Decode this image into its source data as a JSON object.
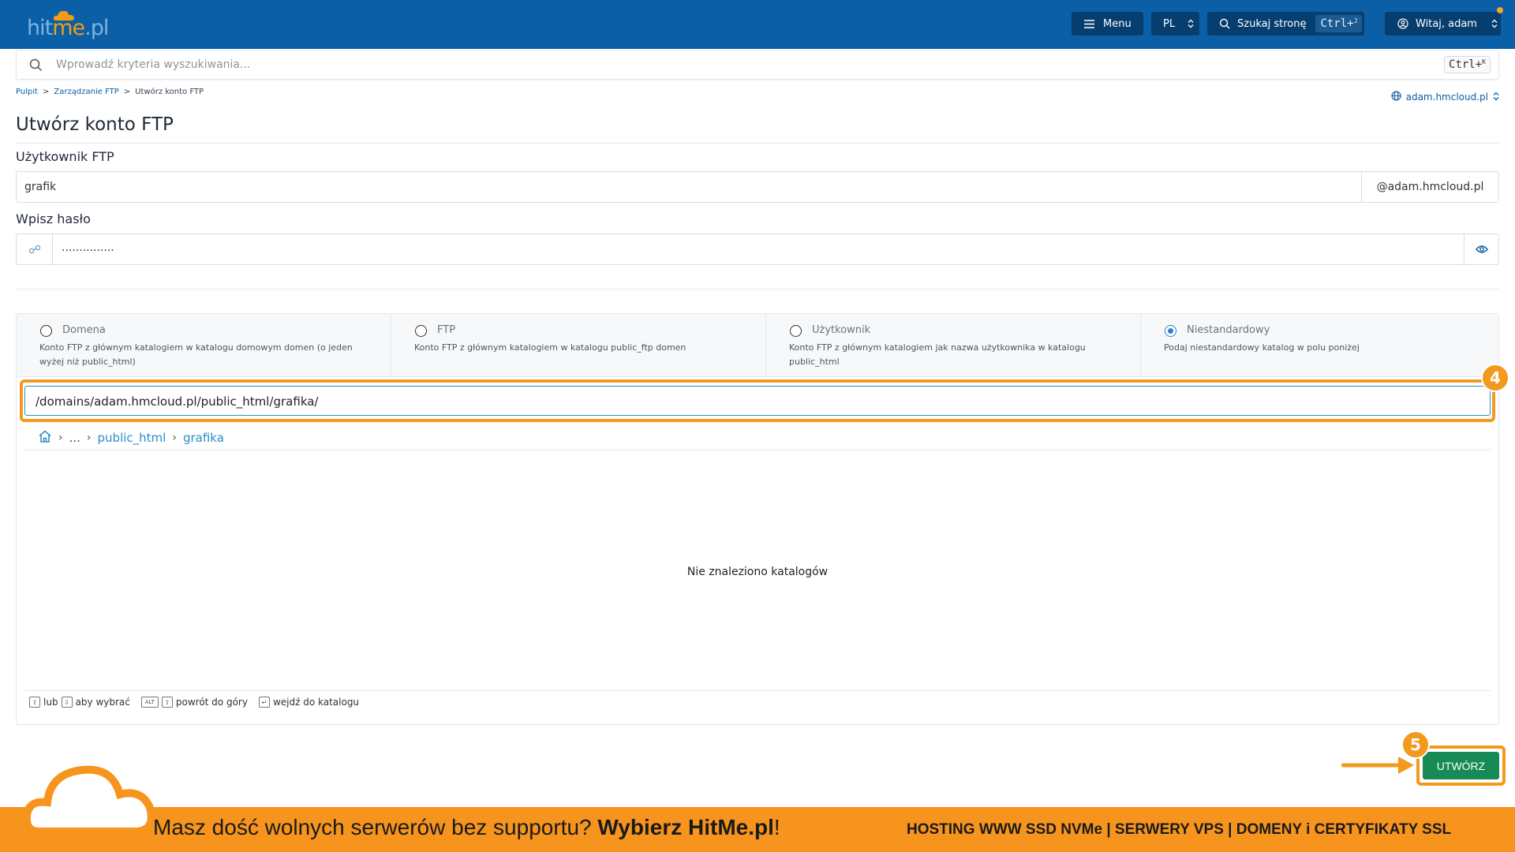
{
  "topbar": {
    "logo": {
      "part1": "hit",
      "part2": "me",
      "part3": ".pl"
    },
    "menu_label": "Menu",
    "lang_label": "PL",
    "search_label": "Szukaj stronę",
    "search_shortcut": "Ctrl+",
    "search_shortcut_key": "J",
    "user_label": "Witaj, adam"
  },
  "search": {
    "placeholder": "Wprowadź kryteria wyszukiwania...",
    "shortcut": "Ctrl+",
    "shortcut_key": "K"
  },
  "breadcrumb": {
    "items": [
      "Pulpit",
      "Zarządzanie FTP",
      "Utwórz konto FTP"
    ],
    "separator": ">"
  },
  "domain_selector": {
    "label": "adam.hmcloud.pl"
  },
  "page": {
    "title": "Utwórz konto FTP"
  },
  "form": {
    "user_label": "Użytkownik FTP",
    "user_value": "grafik",
    "user_suffix": "@adam.hmcloud.pl",
    "password_label": "Wpisz hasło",
    "password_value": "..............."
  },
  "options": [
    {
      "title": "Domena",
      "desc": "Konto FTP z głównym katalogiem w katalogu domowym domen (o jeden wyżej niż public_html)",
      "selected": false
    },
    {
      "title": "FTP",
      "desc": "Konto FTP z głównym katalogiem w katalogu public_ftp domen",
      "selected": false
    },
    {
      "title": "Użytkownik",
      "desc": "Konto FTP z głównym katalogiem jak nazwa użytkownika w katalogu public_html",
      "selected": false
    },
    {
      "title": "Niestandardowy",
      "desc": "Podaj niestandardowy katalog w polu poniżej",
      "selected": true
    }
  ],
  "path": {
    "value": "/domains/adam.hmcloud.pl/public_html/grafika/"
  },
  "file_browser": {
    "crumbs": {
      "dots": "...",
      "folder1": "public_html",
      "folder2": "grafika"
    },
    "empty_text": "Nie znaleziono katalogów",
    "hints": {
      "or": "lub",
      "to_select": "aby wybrać",
      "alt_key": "ALT",
      "back_up": "powrót do góry",
      "enter_dir": "wejdź do katalogu"
    }
  },
  "badges": {
    "step4": "4",
    "step5": "5"
  },
  "create_button": {
    "label": "UTWÓRZ"
  },
  "banner": {
    "text_regular": "Masz dość wolnych serwerów bez supportu? ",
    "text_bold": "Wybierz HitMe.pl",
    "text_end": "!",
    "right_text": "HOSTING WWW SSD NVMe | SERWERY VPS | DOMENY i CERTYFIKATY SSL"
  },
  "colors": {
    "topbar": "#0a5fa6",
    "accent_orange": "#f39a1e",
    "create_green": "#188a55",
    "link_blue": "#2a8cc9"
  }
}
